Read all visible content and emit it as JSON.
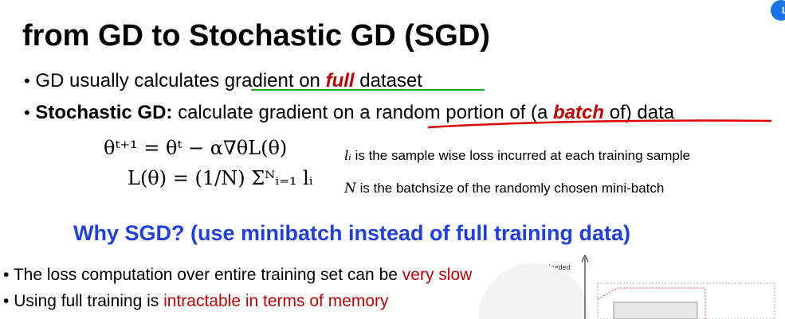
{
  "title": "from GD to Stochastic GD (SGD)",
  "avatar_initial": "L",
  "bullets": {
    "dot": "•",
    "b1_pre": "GD usually calculates gradient on ",
    "b1_em": "full",
    "b1_post": " dataset",
    "b2_bold": "Stochastic GD:",
    "b2_pre": " calculate gradient on a random portion of (a ",
    "b2_em": "batch",
    "b2_post": " of) data"
  },
  "equations": {
    "eq1": "θᵗ⁺¹ = θᵗ − α∇θL(θ)",
    "eq2": "L(θ) = (1/N) Σᴺᵢ₌₁ lᵢ"
  },
  "notes": {
    "n1_var": "lᵢ",
    "n1_text": " is the sample wise loss incurred at each training sample",
    "n2_var": "N",
    "n2_text": " is the batchsize of the randomly chosen mini-batch"
  },
  "why_heading": "Why SGD? (use minibatch instead of full training data)",
  "sub_bullets": {
    "dot": "•",
    "s1_pre": "The loss computation over entire training set can be ",
    "s1_red": "very slow",
    "s2_pre": "Using full training is ",
    "s2_red": "intractable in terms of memory"
  },
  "figure": {
    "ylabel": "Needed GPU memory"
  },
  "colors": {
    "accent_red": "#c00000",
    "heading_blue": "#1f3fe0",
    "underline_green": "#22aa22",
    "annotation_red": "#e00000"
  }
}
